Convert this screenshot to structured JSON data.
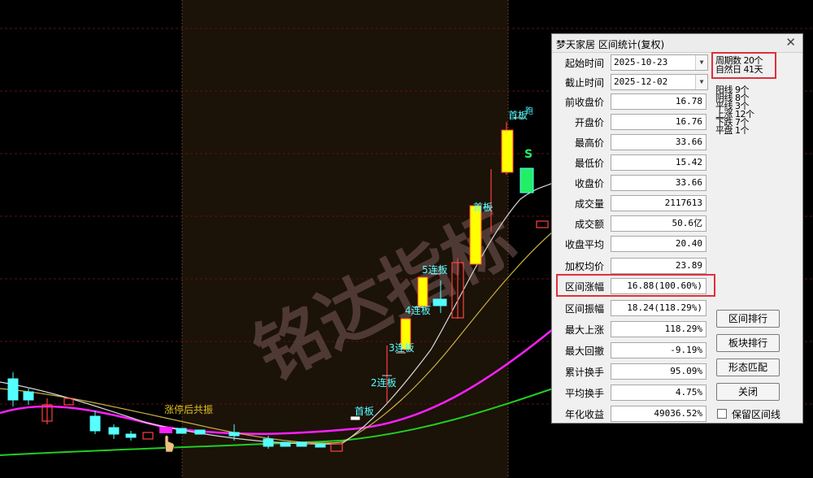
{
  "chart": {
    "watermark": "铭达指标",
    "annotations": [
      "首板",
      "2连板",
      "3连板",
      "4连板",
      "5连板",
      "首板",
      "首板",
      "跑",
      "S",
      "涨停后共振"
    ]
  },
  "dialog": {
    "title": "梦天家居  区间统计(复权)",
    "close_glyph": "✕",
    "start_label": "起始时间",
    "start_value": "2025-10-23",
    "end_label": "截止时间",
    "end_value": "2025-12-02",
    "arrow_glyph": "▼",
    "period_count": "周期数  20个",
    "natural_days": "自然日  41天",
    "stats": [
      "阳线  9个",
      "阴线  8个",
      "平线  3个",
      "上涨  12个",
      "下跌  7个",
      "平盘  1个"
    ],
    "rows": [
      {
        "label": "前收盘价",
        "value": "16.78"
      },
      {
        "label": "开盘价",
        "value": "16.76"
      },
      {
        "label": "最高价",
        "value": "33.66"
      },
      {
        "label": "最低价",
        "value": "15.42"
      },
      {
        "label": "收盘价",
        "value": "33.66"
      },
      {
        "label": "成交量",
        "value": "2117613"
      },
      {
        "label": "成交额",
        "value": "50.6亿"
      },
      {
        "label": "收盘平均",
        "value": "20.40"
      },
      {
        "label": "加权均价",
        "value": "23.89"
      },
      {
        "label": "区间涨幅",
        "value": "16.88(100.60%)"
      },
      {
        "label": "区间振幅",
        "value": "18.24(118.29%)"
      },
      {
        "label": "最大上涨",
        "value": "118.29%"
      },
      {
        "label": "最大回撤",
        "value": "-9.19%"
      },
      {
        "label": "累计换手",
        "value": "95.09%"
      },
      {
        "label": "平均换手",
        "value": "4.75%"
      },
      {
        "label": "年化收益",
        "value": "49036.52%"
      }
    ],
    "buttons": {
      "rank_label": "区间排行",
      "sector_label": "板块排行",
      "pattern_label": "形态匹配",
      "close_label": "关闭"
    },
    "keep_range_label": "保留区间线",
    "colors": {
      "highlight": "#e0303a",
      "up": "#ff4040",
      "down": "#54ffff",
      "limit": "#ffff00"
    }
  }
}
